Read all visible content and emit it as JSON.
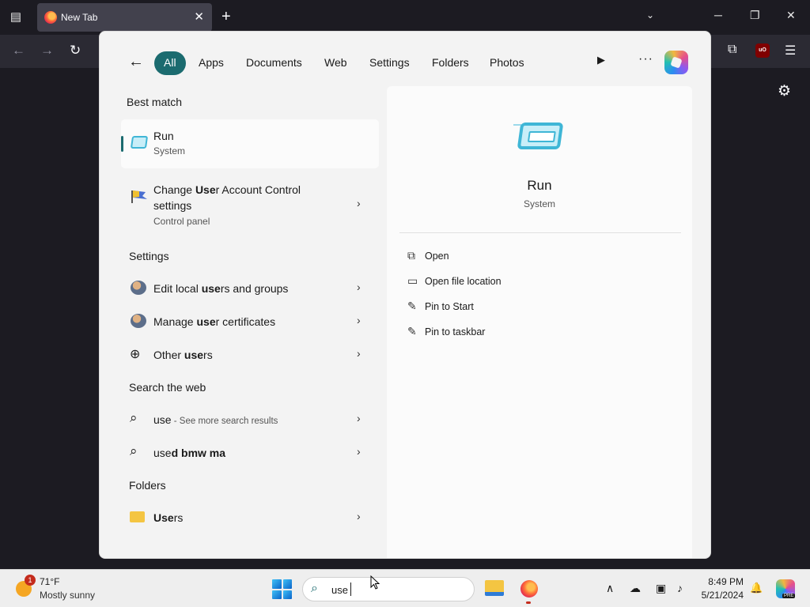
{
  "browser": {
    "tab_title": "New Tab",
    "tab_close": "✕",
    "new_tab": "+",
    "list_all_tabs": "⌄",
    "window_controls": {
      "minimize": "─",
      "maximize": "❐",
      "close": "✕"
    },
    "nav": {
      "back": "←",
      "forward": "→",
      "reload": "↻"
    },
    "extensions_icon": "⧉",
    "ublock_label": "uO",
    "menu_icon": "☰",
    "settings_icon": "⚙"
  },
  "search_panel": {
    "back": "←",
    "filters": [
      "All",
      "Apps",
      "Documents",
      "Web",
      "Settings",
      "Folders",
      "Photos"
    ],
    "selected_filter": "All",
    "play": "▶",
    "more": "···",
    "best_match": {
      "title": "Best match",
      "name": "Run",
      "sub": "System"
    },
    "uac": {
      "pre": "Change ",
      "bold": "Use",
      "post": "r Account Control",
      "line2": "settings",
      "sub": "Control panel"
    },
    "settings_section": "Settings",
    "settings_items": [
      {
        "pre": "Edit local ",
        "bold": "use",
        "post": "rs and groups"
      },
      {
        "pre": "Manage ",
        "bold": "use",
        "post": "r certificates"
      },
      {
        "pre": "Other ",
        "bold": "use",
        "post": "rs"
      }
    ],
    "web_section": "Search the web",
    "web_items": [
      {
        "query": "use",
        "hint": " - See more search results"
      },
      {
        "query_bold": "use",
        "query_rest": "d bmw ma"
      }
    ],
    "folders_section": "Folders",
    "folder_item": {
      "bold": "Use",
      "rest": "rs"
    },
    "chevron": "›",
    "preview": {
      "name": "Run",
      "sub": "System",
      "actions": [
        {
          "icon": "⧉",
          "label": "Open"
        },
        {
          "icon": "▭",
          "label": "Open file location"
        },
        {
          "icon": "✎",
          "label": "Pin to Start"
        },
        {
          "icon": "✎",
          "label": "Pin to taskbar"
        }
      ]
    }
  },
  "taskbar": {
    "weather": {
      "badge": "1",
      "temp": "71°F",
      "condition": "Mostly sunny"
    },
    "search_query": "use",
    "search_icon": "⌕",
    "tray": {
      "overflow": "∧",
      "onedrive": "☁",
      "display": "▣",
      "speaker": "♪",
      "bell": "🔔"
    },
    "time": "8:49 PM",
    "date": "5/21/2024",
    "copilot_badge": "PRE"
  }
}
